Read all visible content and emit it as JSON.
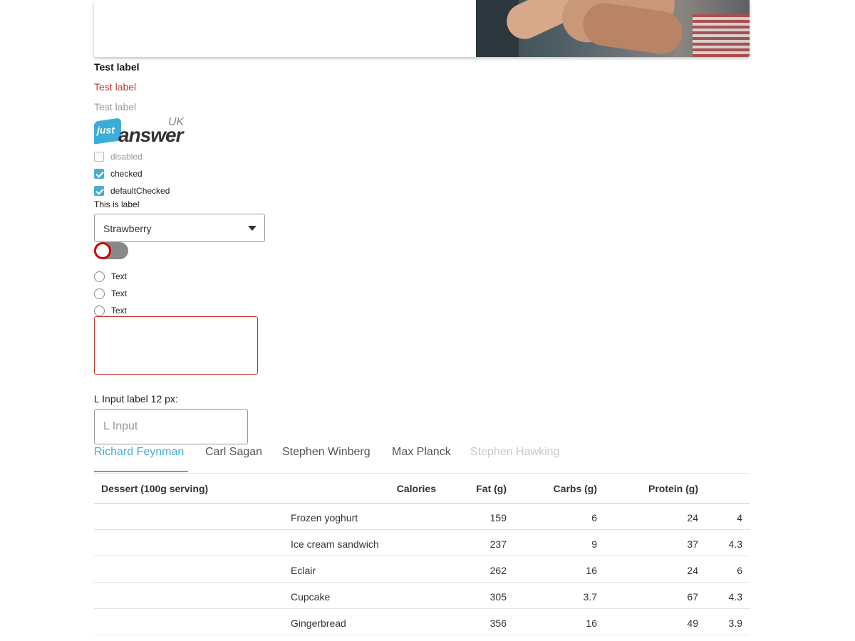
{
  "labels": {
    "bold": "Test label",
    "error": "Test label",
    "muted": "Test label"
  },
  "logo": {
    "bubble": "just",
    "word": "answer",
    "region": "UK"
  },
  "checkboxes": [
    {
      "label": "disabled",
      "state": "disabled"
    },
    {
      "label": "checked",
      "state": "checked"
    },
    {
      "label": "defaultChecked",
      "state": "checked"
    }
  ],
  "select": {
    "label": "This is label",
    "value": "Strawberry"
  },
  "toggle": {
    "on": false
  },
  "radios": [
    {
      "label": "Text"
    },
    {
      "label": "Text"
    },
    {
      "label": "Text"
    }
  ],
  "l_input": {
    "label": "L Input label 12 px:",
    "placeholder": "L Input"
  },
  "tabs": [
    {
      "label": "Richard Feynman",
      "state": "active"
    },
    {
      "label": "Carl Sagan",
      "state": "normal"
    },
    {
      "label": "Stephen Winberg",
      "state": "normal"
    },
    {
      "label": "Max Planck",
      "state": "normal"
    },
    {
      "label": "Stephen Hawking",
      "state": "disabled"
    }
  ],
  "table": {
    "headers": [
      "Dessert (100g serving)",
      "Calories",
      "Fat (g)",
      "Carbs (g)",
      "Protein (g)"
    ],
    "rows": [
      [
        "Frozen yoghurt",
        "159",
        "6",
        "24",
        "4"
      ],
      [
        "Ice cream sandwich",
        "237",
        "9",
        "37",
        "4.3"
      ],
      [
        "Eclair",
        "262",
        "16",
        "24",
        "6"
      ],
      [
        "Cupcake",
        "305",
        "3.7",
        "67",
        "4.3"
      ],
      [
        "Gingerbread",
        "356",
        "16",
        "49",
        "3.9"
      ]
    ]
  },
  "colors": {
    "accent": "#4aaed1",
    "error": "#c0392b",
    "toggle_knob_border": "#d40000"
  }
}
